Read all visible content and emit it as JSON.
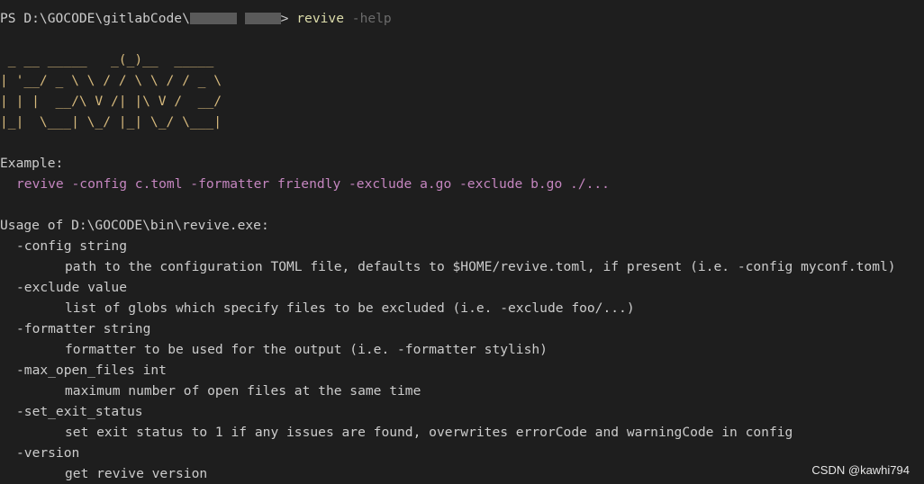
{
  "prompt": {
    "path": "PS D:\\GOCODE\\gitlabCode\\",
    "suffix": ">",
    "command": "revive",
    "argument": "-help"
  },
  "ascii_art": [
    " _ __ _____   _(_)__  _____",
    "| '__/ _ \\ \\ / / \\ \\ / / _ \\",
    "| | |  __/\\ V /| |\\ V /  __/",
    "|_|  \\___| \\_/ |_| \\_/ \\___|"
  ],
  "example": {
    "label": "Example:",
    "command": "revive -config c.toml -formatter friendly -exclude a.go -exclude b.go ./..."
  },
  "usage": {
    "header": "Usage of D:\\GOCODE\\bin\\revive.exe:",
    "flags": [
      {
        "flag": "-config string",
        "description": "path to the configuration TOML file, defaults to $HOME/revive.toml, if present (i.e. -config myconf.toml)"
      },
      {
        "flag": "-exclude value",
        "description": "list of globs which specify files to be excluded (i.e. -exclude foo/...)"
      },
      {
        "flag": "-formatter string",
        "description": "formatter to be used for the output (i.e. -formatter stylish)"
      },
      {
        "flag": "-max_open_files int",
        "description": "maximum number of open files at the same time"
      },
      {
        "flag": "-set_exit_status",
        "description": "set exit status to 1 if any issues are found, overwrites errorCode and warningCode in config"
      },
      {
        "flag": "-version",
        "description": "get revive version"
      }
    ]
  },
  "watermark": "CSDN @kawhi794",
  "colors": {
    "background": "#1e1e1e",
    "text": "#cccccc",
    "command": "#dcdcaa",
    "argument": "#6b6b6b",
    "ascii_art": "#d7ba7d",
    "example": "#c586c0"
  }
}
